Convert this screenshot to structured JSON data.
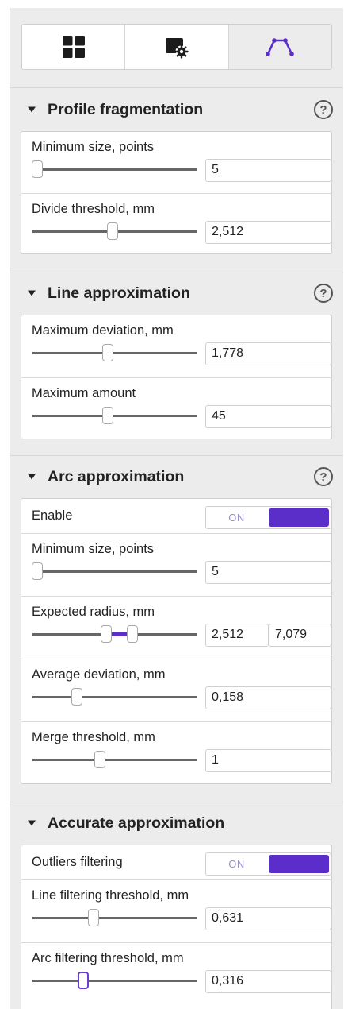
{
  "tabs": [
    {
      "icon": "grid-icon"
    },
    {
      "icon": "window-settings-icon"
    },
    {
      "icon": "profile-polyline-icon"
    }
  ],
  "accent_color": "#5b2ec9",
  "sections": {
    "profile_fragmentation": {
      "title": "Profile fragmentation",
      "help": "?",
      "minimum_size": {
        "label": "Minimum size, points",
        "value": "5",
        "slider_fraction": 0.03
      },
      "divide_threshold": {
        "label": "Divide threshold, mm",
        "value": "2,512",
        "slider_fraction": 0.49
      }
    },
    "line_approximation": {
      "title": "Line approximation",
      "help": "?",
      "maximum_deviation": {
        "label": "Maximum deviation, mm",
        "value": "1,778",
        "slider_fraction": 0.46
      },
      "maximum_amount": {
        "label": "Maximum amount",
        "value": "45",
        "slider_fraction": 0.46
      }
    },
    "arc_approximation": {
      "title": "Arc approximation",
      "help": "?",
      "enable": {
        "label": "Enable",
        "toggle_text": "ON",
        "state": true
      },
      "minimum_size": {
        "label": "Minimum size, points",
        "value": "5",
        "slider_fraction": 0.03
      },
      "expected_radius": {
        "label": "Expected radius, mm",
        "value_min": "2,512",
        "value_max": "7,079",
        "slider_min_fraction": 0.45,
        "slider_max_fraction": 0.61
      },
      "average_deviation": {
        "label": "Average deviation, mm",
        "value": "0,158",
        "slider_fraction": 0.27
      },
      "merge_threshold": {
        "label": "Merge threshold, mm",
        "value": "1",
        "slider_fraction": 0.41
      }
    },
    "accurate_approximation": {
      "title": "Accurate approximation",
      "outliers_filtering": {
        "label": "Outliers filtering",
        "toggle_text": "ON",
        "state": true
      },
      "line_filtering_threshold": {
        "label": "Line filtering threshold, mm",
        "value": "0,631",
        "slider_fraction": 0.37
      },
      "arc_filtering_threshold": {
        "label": "Arc filtering threshold, mm",
        "value": "0,316",
        "slider_fraction": 0.31
      }
    }
  }
}
